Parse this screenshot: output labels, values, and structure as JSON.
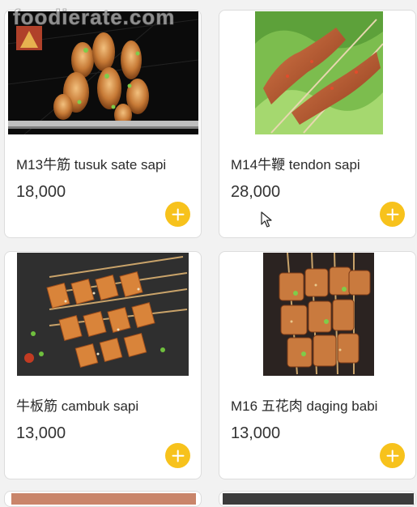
{
  "watermark": "foodierate.com",
  "accent": "#f7c21c",
  "products": [
    {
      "name": "M13牛筋 tusuk sate sapi",
      "price": "18,000"
    },
    {
      "name": "M14牛鞭 tendon sapi",
      "price": "28,000"
    },
    {
      "name": "牛板筋 cambuk sapi",
      "price": "13,000"
    },
    {
      "name": "M16 五花肉 daging babi",
      "price": "13,000"
    }
  ],
  "icons": {
    "add": "plus-circle-icon",
    "cursor": "mouse-pointer-icon"
  }
}
